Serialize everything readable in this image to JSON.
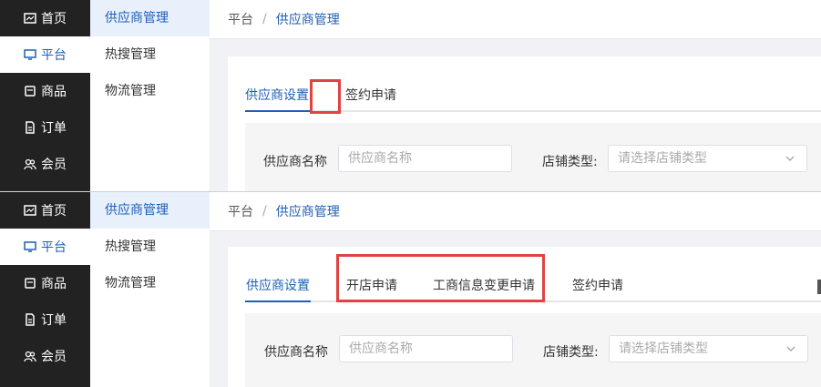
{
  "sidebar": {
    "items": [
      {
        "label": "首页",
        "icon": "dashboard-icon"
      },
      {
        "label": "平台",
        "icon": "monitor-icon"
      },
      {
        "label": "商品",
        "icon": "product-icon"
      },
      {
        "label": "订单",
        "icon": "document-icon"
      },
      {
        "label": "会员",
        "icon": "user-group-icon"
      }
    ]
  },
  "submenu": {
    "items": [
      "供应商管理",
      "热搜管理",
      "物流管理"
    ]
  },
  "breadcrumb": {
    "root": "平台",
    "separator": "/",
    "current": "供应商管理"
  },
  "top_tabs": [
    "供应商设置",
    "签约申请"
  ],
  "bottom_tabs": [
    "供应商设置",
    "开店申请",
    "工商信息变更申请",
    "签约申请"
  ],
  "filters": {
    "name_label": "供应商名称",
    "name_placeholder": "供应商名称",
    "shop_type_label": "店铺类型:",
    "shop_type_placeholder": "请选择店铺类型"
  },
  "colors": {
    "accent": "#1f5fb5",
    "sidebar_bg": "#222222",
    "highlight": "#e04343"
  }
}
